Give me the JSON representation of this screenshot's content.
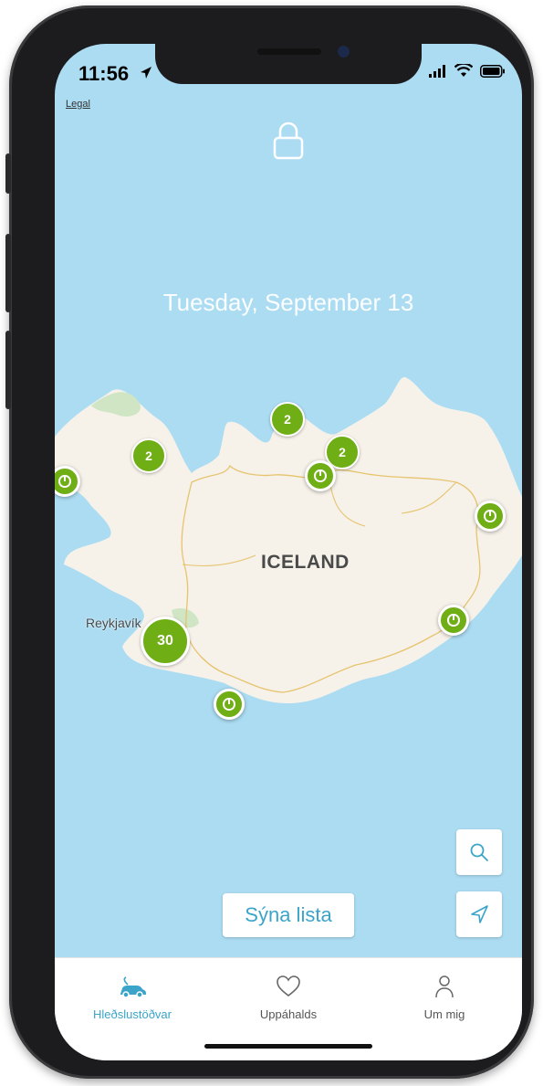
{
  "status_bar": {
    "time": "11:56"
  },
  "map": {
    "legal_label": "Legal",
    "country_label": "ICELAND",
    "city_label": "Reykjavík",
    "clusters": [
      "2",
      "2",
      "2",
      "30"
    ]
  },
  "lock_screen": {
    "date": "Tuesday, September 13"
  },
  "actions": {
    "show_list_label": "Sýna lista"
  },
  "tabbar": {
    "tabs": [
      {
        "label": "Hleðslustöðvar",
        "icon": "ev-car-icon",
        "active": true
      },
      {
        "label": "Uppáhalds",
        "icon": "heart-icon",
        "active": false
      },
      {
        "label": "Um mig",
        "icon": "person-icon",
        "active": false
      }
    ]
  },
  "colors": {
    "water": "#acdcf2",
    "land": "#f6f2ea",
    "cluster_green": "#6fae15",
    "accent": "#3ba4c8"
  }
}
